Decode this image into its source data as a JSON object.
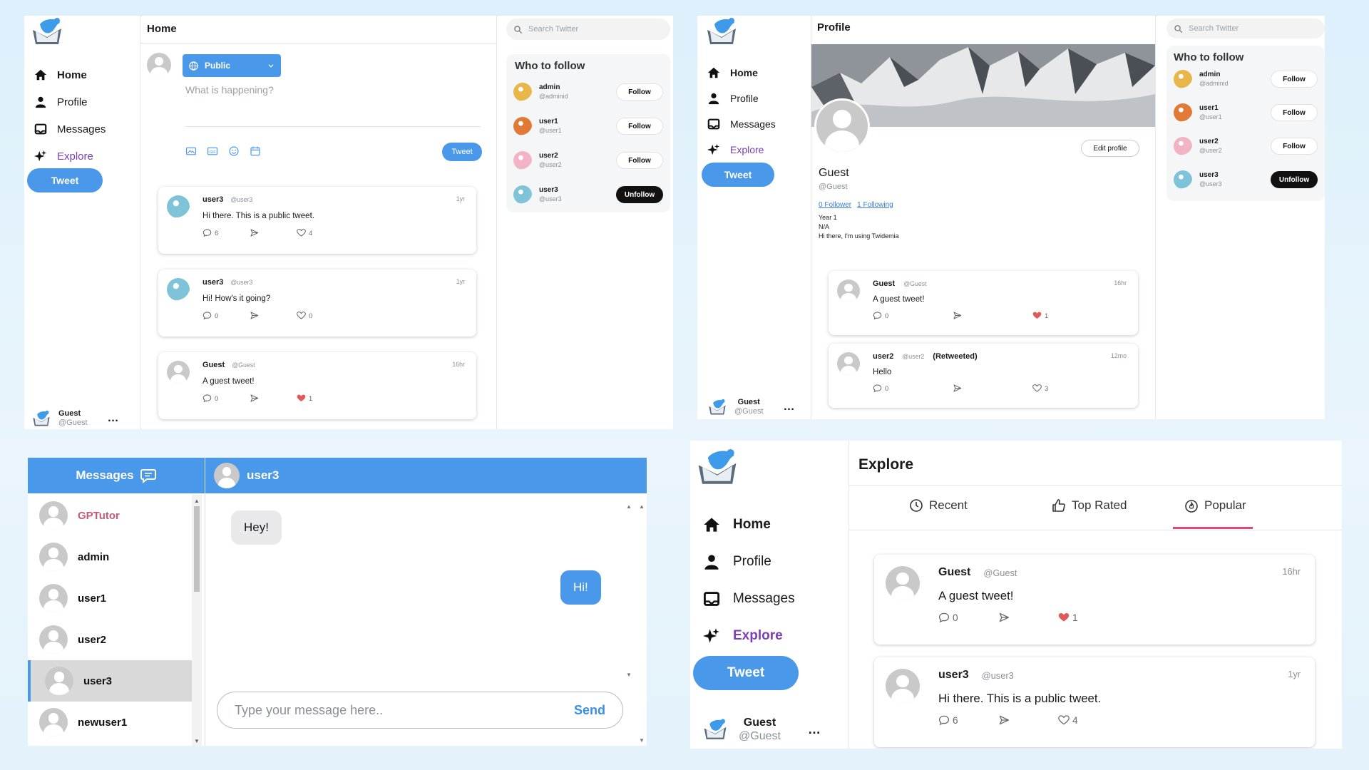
{
  "home": {
    "header_title": "Home",
    "nav": [
      "Home",
      "Profile",
      "Messages",
      "Explore"
    ],
    "tweet_button": "Tweet",
    "visibility_label": "Public",
    "compose_placeholder": "What is happening?",
    "compose_tweet_button": "Tweet",
    "user_name": "Guest",
    "user_handle": "@Guest",
    "more": "…",
    "search_placeholder": "Search Twitter",
    "who_to_follow": {
      "title": "Who to follow",
      "items": [
        {
          "name": "admin",
          "handle": "@adminid",
          "action": "Follow",
          "avatar_color": "#e8b649"
        },
        {
          "name": "user1",
          "handle": "@user1",
          "action": "Follow",
          "avatar_color": "#e07a36"
        },
        {
          "name": "user2",
          "handle": "@user2",
          "action": "Follow",
          "avatar_color": "#f2b3c4"
        },
        {
          "name": "user3",
          "handle": "@user3",
          "action": "Unfollow",
          "avatar_color": "#7ec3d8"
        }
      ]
    },
    "tweets": [
      {
        "name": "user3",
        "handle": "@user3",
        "time": "1yr",
        "text": "Hi there. This is a public tweet.",
        "comments": "6",
        "likes": "4",
        "liked": false,
        "avatar_color": "#7ec3d8"
      },
      {
        "name": "user3",
        "handle": "@user3",
        "time": "1yr",
        "text": "Hi! How's it going?",
        "comments": "0",
        "likes": "0",
        "liked": false,
        "avatar_color": "#7ec3d8"
      },
      {
        "name": "Guest",
        "handle": "@Guest",
        "time": "16hr",
        "text": "A guest tweet!",
        "comments": "0",
        "likes": "1",
        "liked": true,
        "avatar_color": "#c9c9c9"
      }
    ]
  },
  "profile": {
    "header_title": "Profile",
    "nav": [
      "Home",
      "Profile",
      "Messages",
      "Explore"
    ],
    "tweet_button": "Tweet",
    "edit_profile": "Edit profile",
    "name": "Guest",
    "handle": "@Guest",
    "followers": "0 Follower",
    "following": "1 Following",
    "year": "Year 1",
    "location": "N/A",
    "bio": "Hi there, I'm using Twidemia",
    "user_name": "Guest",
    "user_handle": "@Guest",
    "more": "…",
    "search_placeholder": "Search Twitter",
    "who_to_follow": {
      "title": "Who to follow",
      "items": [
        {
          "name": "admin",
          "handle": "@adminid",
          "action": "Follow",
          "avatar_color": "#e8b649"
        },
        {
          "name": "user1",
          "handle": "@user1",
          "action": "Follow",
          "avatar_color": "#e07a36"
        },
        {
          "name": "user2",
          "handle": "@user2",
          "action": "Follow",
          "avatar_color": "#f2b3c4"
        },
        {
          "name": "user3",
          "handle": "@user3",
          "action": "Unfollow",
          "avatar_color": "#7ec3d8"
        }
      ]
    },
    "tweets": [
      {
        "name": "Guest",
        "handle": "@Guest",
        "time": "16hr",
        "text": "A guest tweet!",
        "comments": "0",
        "likes": "1",
        "liked": true,
        "retweeted": ""
      },
      {
        "name": "user2",
        "handle": "@user2",
        "time": "12mo",
        "text": "Hello",
        "comments": "0",
        "likes": "3",
        "liked": false,
        "retweeted": "(Retweeted)"
      }
    ]
  },
  "messages": {
    "title": "Messages",
    "active_chat": "user3",
    "contacts": [
      "GPTutor",
      "admin",
      "user1",
      "user2",
      "user3",
      "newuser1"
    ],
    "selected_contact": "user3",
    "chat": [
      {
        "from": "them",
        "text": "Hey!"
      },
      {
        "from": "me",
        "text": "Hi!"
      }
    ],
    "input_placeholder": "Type your message here..",
    "send_label": "Send"
  },
  "explore": {
    "header_title": "Explore",
    "nav": [
      "Home",
      "Profile",
      "Messages",
      "Explore"
    ],
    "tweet_button": "Tweet",
    "tabs": [
      "Recent",
      "Top Rated",
      "Popular"
    ],
    "active_tab": "Popular",
    "user_name": "Guest",
    "user_handle": "@Guest",
    "more": "…",
    "tweets": [
      {
        "name": "Guest",
        "handle": "@Guest",
        "time": "16hr",
        "text": "A guest tweet!",
        "comments": "0",
        "likes": "1",
        "liked": true
      },
      {
        "name": "user3",
        "handle": "@user3",
        "time": "1yr",
        "text": "Hi there. This is a public tweet.",
        "comments": "6",
        "likes": "4",
        "liked": false
      }
    ]
  },
  "colors": {
    "accent": "#4a98e9",
    "explore": "#7b3fb7",
    "like": "#e05a5a",
    "tab_underline": "#e0457b",
    "gptutor": "#c45a7a"
  }
}
